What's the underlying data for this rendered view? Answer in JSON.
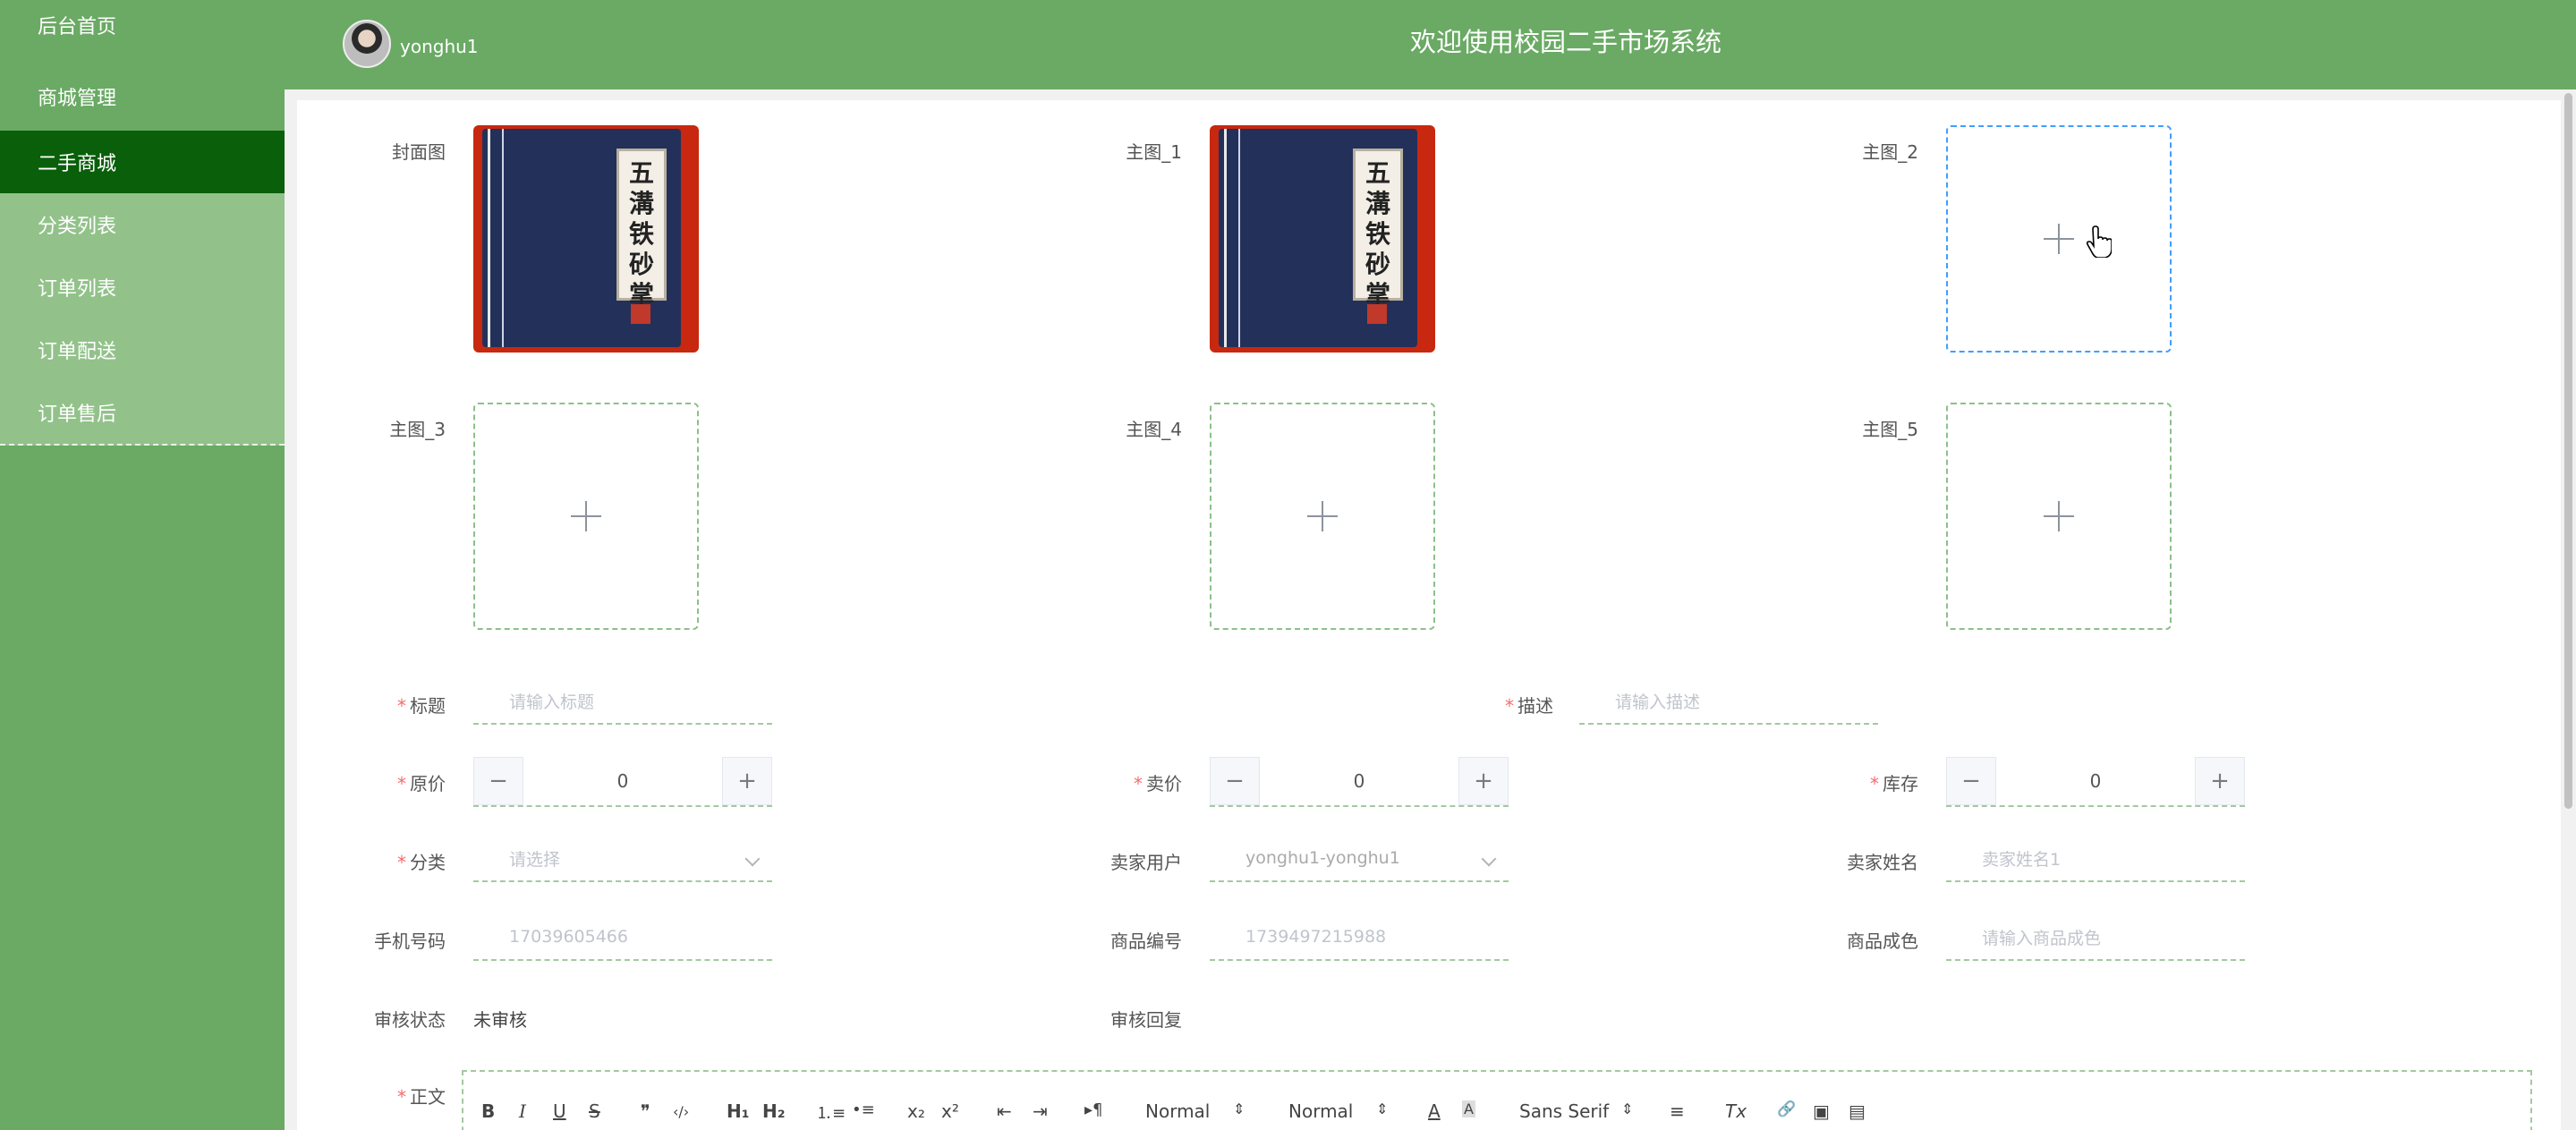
{
  "sidebar": {
    "items": [
      {
        "label": "后台首页"
      },
      {
        "label": "商城管理"
      },
      {
        "label": "二手商城"
      },
      {
        "label": "分类列表"
      },
      {
        "label": "订单列表"
      },
      {
        "label": "订单配送"
      },
      {
        "label": "订单售后"
      }
    ]
  },
  "header": {
    "username": "yonghu1",
    "title": "欢迎使用校园二手市场系统"
  },
  "form": {
    "images": {
      "cover_label": "封面图",
      "main1_label": "主图_1",
      "main2_label": "主图_2",
      "main3_label": "主图_3",
      "main4_label": "主图_4",
      "main5_label": "主图_5"
    },
    "book_chars": [
      "五",
      "溝",
      "铁",
      "砂",
      "掌"
    ],
    "title": {
      "label": "标题",
      "placeholder": "请输入标题"
    },
    "desc": {
      "label": "描述",
      "placeholder": "请输入描述"
    },
    "original_price": {
      "label": "原价",
      "value": "0"
    },
    "sale_price": {
      "label": "卖价",
      "value": "0"
    },
    "stock": {
      "label": "库存",
      "value": "0"
    },
    "category": {
      "label": "分类",
      "placeholder": "请选择"
    },
    "seller_user": {
      "label": "卖家用户",
      "value": "yonghu1-yonghu1"
    },
    "seller_name": {
      "label": "卖家姓名",
      "placeholder": "卖家姓名1"
    },
    "phone": {
      "label": "手机号码",
      "value": "17039605466"
    },
    "product_no": {
      "label": "商品编号",
      "value": "1739497215988"
    },
    "condition": {
      "label": "商品成色",
      "placeholder": "请输入商品成色"
    },
    "audit_status": {
      "label": "审核状态",
      "value": "未审核"
    },
    "audit_reply": {
      "label": "审核回复"
    },
    "body": {
      "label": "正文"
    },
    "stepper_minus": "−",
    "stepper_plus": "+"
  },
  "editor_toolbar": {
    "bold": "B",
    "italic": "I",
    "underline": "U",
    "strike": "S",
    "blockquote": "❞",
    "code": "‹/›",
    "h1": "H₁",
    "h2": "H₂",
    "ordered_list": "⒈≡",
    "bullet_list": "•≡",
    "subscript": "x₂",
    "superscript": "x²",
    "outdent": "⇤",
    "indent": "⇥",
    "direction": "▸¶",
    "size": "Normal",
    "header": "Normal",
    "color": "A",
    "background": "A",
    "font": "Sans Serif",
    "align": "≡",
    "clean": "Tx",
    "link": "🔗",
    "image": "▣",
    "video": "▤",
    "dropdown_arrow": "⇕"
  }
}
